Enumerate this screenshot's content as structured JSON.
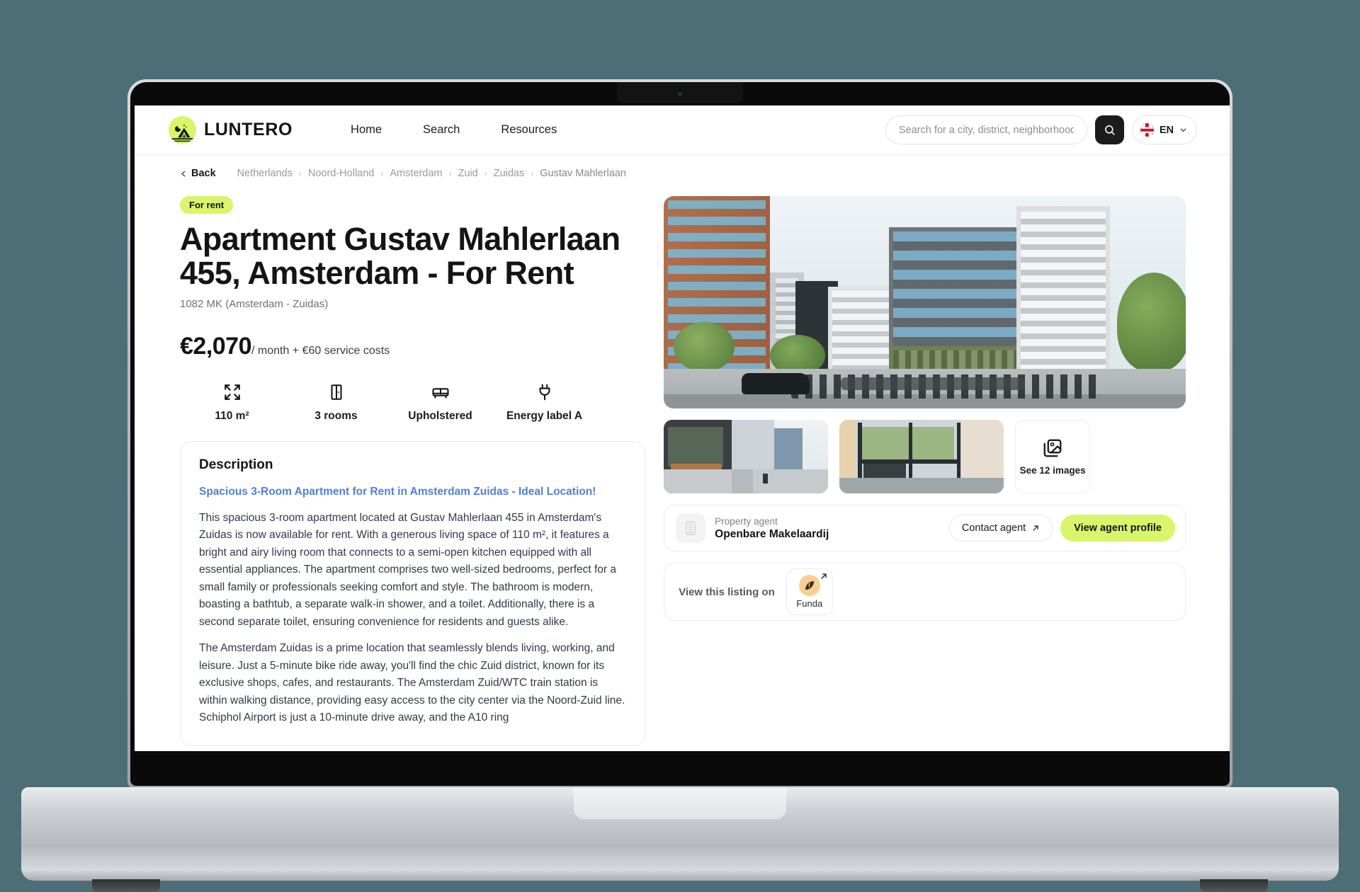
{
  "brand": {
    "name": "LUNTERO",
    "logo_icon": "tent-moon-logo",
    "accent": "#d9f56a"
  },
  "nav": [
    {
      "label": "Home"
    },
    {
      "label": "Search"
    },
    {
      "label": "Resources"
    }
  ],
  "search": {
    "placeholder": "Search for a city, district, neighborhood...",
    "value": "",
    "button_icon": "search-icon"
  },
  "language": {
    "label": "EN",
    "flag": "uk-flag-icon",
    "chevron": "chevron-down-icon"
  },
  "breadcrumb": {
    "back_label": "Back",
    "back_icon": "chevron-left-icon",
    "items": [
      "Netherlands",
      "Noord-Holland",
      "Amsterdam",
      "Zuid",
      "Zuidas",
      "Gustav Mahlerlaan"
    ],
    "separator": "›"
  },
  "listing": {
    "badge": "For rent",
    "title": "Apartment Gustav Mahlerlaan 455, Amsterdam - For Rent",
    "subtitle": "1082 MK (Amsterdam - Zuidas)",
    "price": "€2,070",
    "price_unit": "/ month + €60 service costs",
    "features": [
      {
        "icon": "expand-arrows-icon",
        "label": "110 m²"
      },
      {
        "icon": "door-icon",
        "label": "3 rooms"
      },
      {
        "icon": "sofa-icon",
        "label": "Upholstered"
      },
      {
        "icon": "power-plug-icon",
        "label": "Energy label A"
      }
    ]
  },
  "description": {
    "heading": "Description",
    "lead": "Spacious 3-Room Apartment for Rent in Amsterdam Zuidas - Ideal Location!",
    "paragraph1": "This spacious 3-room apartment located at Gustav Mahlerlaan 455 in Amsterdam's Zuidas is now available for rent. With a generous living space of 110 m², it features a bright and airy living room that connects to a semi-open kitchen equipped with all essential appliances. The apartment comprises two well-sized bedrooms, perfect for a small family or professionals seeking comfort and style. The bathroom is modern, boasting a bathtub, a separate walk-in shower, and a toilet. Additionally, there is a second separate toilet, ensuring convenience for residents and guests alike.",
    "paragraph2": "The Amsterdam Zuidas is a prime location that seamlessly blends living, working, and leisure. Just a 5-minute bike ride away, you'll find the chic Zuid district, known for its exclusive shops, cafes, and restaurants. The Amsterdam Zuid/WTC train station is within walking distance, providing easy access to the city center via the Noord-Zuid line. Schiphol Airport is just a 10-minute drive away, and the A10 ring"
  },
  "gallery": {
    "hero_alt": "street-view-of-apartment-building",
    "thumbnails": [
      {
        "alt": "street-level-storefront"
      },
      {
        "alt": "building-lobby-entrance"
      }
    ],
    "more_label": "See 12 images",
    "more_icon": "images-icon"
  },
  "agent": {
    "role": "Property agent",
    "name": "Openbare Makelaardij",
    "avatar_icon": "building-icon",
    "contact_label": "Contact agent",
    "contact_icon": "arrow-up-right-icon",
    "profile_label": "View agent profile"
  },
  "external": {
    "label": "View this listing on",
    "site_name": "Funda",
    "logo_icon": "funda-logo",
    "arrow_icon": "arrow-up-right-icon"
  }
}
